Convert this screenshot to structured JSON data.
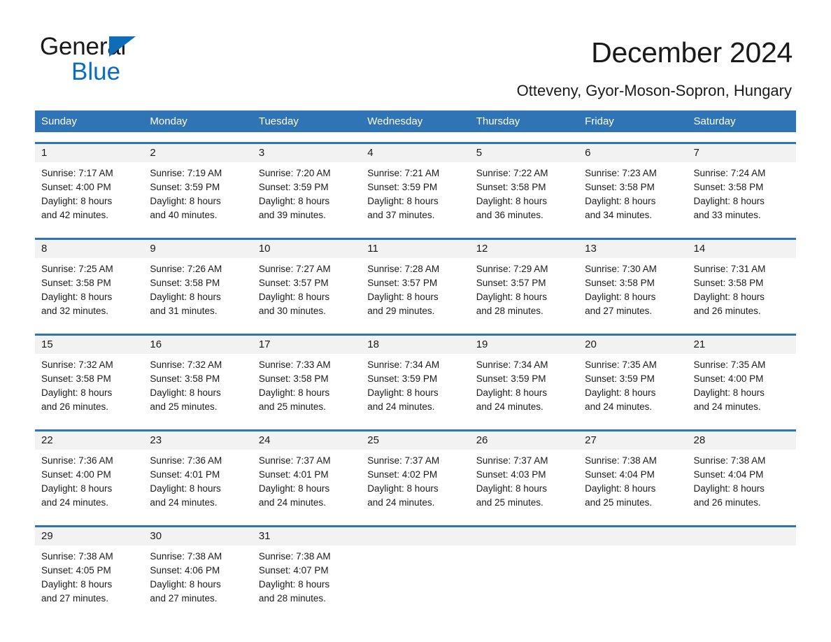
{
  "brand": {
    "name_part1": "General",
    "name_part2": "Blue",
    "accent_color": "#0f6cb6"
  },
  "header": {
    "title": "December 2024",
    "location": "Otteveny, Gyor-Moson-Sopron, Hungary",
    "header_bg_color": "#2f75b5",
    "day_band_color": "#f2f2f2"
  },
  "weekday_names": [
    "Sunday",
    "Monday",
    "Tuesday",
    "Wednesday",
    "Thursday",
    "Friday",
    "Saturday"
  ],
  "weeks": [
    {
      "days": [
        {
          "num": "1",
          "l1": "Sunrise: 7:17 AM",
          "l2": "Sunset: 4:00 PM",
          "l3": "Daylight: 8 hours",
          "l4": "and 42 minutes."
        },
        {
          "num": "2",
          "l1": "Sunrise: 7:19 AM",
          "l2": "Sunset: 3:59 PM",
          "l3": "Daylight: 8 hours",
          "l4": "and 40 minutes."
        },
        {
          "num": "3",
          "l1": "Sunrise: 7:20 AM",
          "l2": "Sunset: 3:59 PM",
          "l3": "Daylight: 8 hours",
          "l4": "and 39 minutes."
        },
        {
          "num": "4",
          "l1": "Sunrise: 7:21 AM",
          "l2": "Sunset: 3:59 PM",
          "l3": "Daylight: 8 hours",
          "l4": "and 37 minutes."
        },
        {
          "num": "5",
          "l1": "Sunrise: 7:22 AM",
          "l2": "Sunset: 3:58 PM",
          "l3": "Daylight: 8 hours",
          "l4": "and 36 minutes."
        },
        {
          "num": "6",
          "l1": "Sunrise: 7:23 AM",
          "l2": "Sunset: 3:58 PM",
          "l3": "Daylight: 8 hours",
          "l4": "and 34 minutes."
        },
        {
          "num": "7",
          "l1": "Sunrise: 7:24 AM",
          "l2": "Sunset: 3:58 PM",
          "l3": "Daylight: 8 hours",
          "l4": "and 33 minutes."
        }
      ]
    },
    {
      "days": [
        {
          "num": "8",
          "l1": "Sunrise: 7:25 AM",
          "l2": "Sunset: 3:58 PM",
          "l3": "Daylight: 8 hours",
          "l4": "and 32 minutes."
        },
        {
          "num": "9",
          "l1": "Sunrise: 7:26 AM",
          "l2": "Sunset: 3:58 PM",
          "l3": "Daylight: 8 hours",
          "l4": "and 31 minutes."
        },
        {
          "num": "10",
          "l1": "Sunrise: 7:27 AM",
          "l2": "Sunset: 3:57 PM",
          "l3": "Daylight: 8 hours",
          "l4": "and 30 minutes."
        },
        {
          "num": "11",
          "l1": "Sunrise: 7:28 AM",
          "l2": "Sunset: 3:57 PM",
          "l3": "Daylight: 8 hours",
          "l4": "and 29 minutes."
        },
        {
          "num": "12",
          "l1": "Sunrise: 7:29 AM",
          "l2": "Sunset: 3:57 PM",
          "l3": "Daylight: 8 hours",
          "l4": "and 28 minutes."
        },
        {
          "num": "13",
          "l1": "Sunrise: 7:30 AM",
          "l2": "Sunset: 3:58 PM",
          "l3": "Daylight: 8 hours",
          "l4": "and 27 minutes."
        },
        {
          "num": "14",
          "l1": "Sunrise: 7:31 AM",
          "l2": "Sunset: 3:58 PM",
          "l3": "Daylight: 8 hours",
          "l4": "and 26 minutes."
        }
      ]
    },
    {
      "days": [
        {
          "num": "15",
          "l1": "Sunrise: 7:32 AM",
          "l2": "Sunset: 3:58 PM",
          "l3": "Daylight: 8 hours",
          "l4": "and 26 minutes."
        },
        {
          "num": "16",
          "l1": "Sunrise: 7:32 AM",
          "l2": "Sunset: 3:58 PM",
          "l3": "Daylight: 8 hours",
          "l4": "and 25 minutes."
        },
        {
          "num": "17",
          "l1": "Sunrise: 7:33 AM",
          "l2": "Sunset: 3:58 PM",
          "l3": "Daylight: 8 hours",
          "l4": "and 25 minutes."
        },
        {
          "num": "18",
          "l1": "Sunrise: 7:34 AM",
          "l2": "Sunset: 3:59 PM",
          "l3": "Daylight: 8 hours",
          "l4": "and 24 minutes."
        },
        {
          "num": "19",
          "l1": "Sunrise: 7:34 AM",
          "l2": "Sunset: 3:59 PM",
          "l3": "Daylight: 8 hours",
          "l4": "and 24 minutes."
        },
        {
          "num": "20",
          "l1": "Sunrise: 7:35 AM",
          "l2": "Sunset: 3:59 PM",
          "l3": "Daylight: 8 hours",
          "l4": "and 24 minutes."
        },
        {
          "num": "21",
          "l1": "Sunrise: 7:35 AM",
          "l2": "Sunset: 4:00 PM",
          "l3": "Daylight: 8 hours",
          "l4": "and 24 minutes."
        }
      ]
    },
    {
      "days": [
        {
          "num": "22",
          "l1": "Sunrise: 7:36 AM",
          "l2": "Sunset: 4:00 PM",
          "l3": "Daylight: 8 hours",
          "l4": "and 24 minutes."
        },
        {
          "num": "23",
          "l1": "Sunrise: 7:36 AM",
          "l2": "Sunset: 4:01 PM",
          "l3": "Daylight: 8 hours",
          "l4": "and 24 minutes."
        },
        {
          "num": "24",
          "l1": "Sunrise: 7:37 AM",
          "l2": "Sunset: 4:01 PM",
          "l3": "Daylight: 8 hours",
          "l4": "and 24 minutes."
        },
        {
          "num": "25",
          "l1": "Sunrise: 7:37 AM",
          "l2": "Sunset: 4:02 PM",
          "l3": "Daylight: 8 hours",
          "l4": "and 24 minutes."
        },
        {
          "num": "26",
          "l1": "Sunrise: 7:37 AM",
          "l2": "Sunset: 4:03 PM",
          "l3": "Daylight: 8 hours",
          "l4": "and 25 minutes."
        },
        {
          "num": "27",
          "l1": "Sunrise: 7:38 AM",
          "l2": "Sunset: 4:04 PM",
          "l3": "Daylight: 8 hours",
          "l4": "and 25 minutes."
        },
        {
          "num": "28",
          "l1": "Sunrise: 7:38 AM",
          "l2": "Sunset: 4:04 PM",
          "l3": "Daylight: 8 hours",
          "l4": "and 26 minutes."
        }
      ]
    },
    {
      "days": [
        {
          "num": "29",
          "l1": "Sunrise: 7:38 AM",
          "l2": "Sunset: 4:05 PM",
          "l3": "Daylight: 8 hours",
          "l4": "and 27 minutes."
        },
        {
          "num": "30",
          "l1": "Sunrise: 7:38 AM",
          "l2": "Sunset: 4:06 PM",
          "l3": "Daylight: 8 hours",
          "l4": "and 27 minutes."
        },
        {
          "num": "31",
          "l1": "Sunrise: 7:38 AM",
          "l2": "Sunset: 4:07 PM",
          "l3": "Daylight: 8 hours",
          "l4": "and 28 minutes."
        },
        {
          "num": "",
          "l1": "",
          "l2": "",
          "l3": "",
          "l4": ""
        },
        {
          "num": "",
          "l1": "",
          "l2": "",
          "l3": "",
          "l4": ""
        },
        {
          "num": "",
          "l1": "",
          "l2": "",
          "l3": "",
          "l4": ""
        },
        {
          "num": "",
          "l1": "",
          "l2": "",
          "l3": "",
          "l4": ""
        }
      ]
    }
  ]
}
